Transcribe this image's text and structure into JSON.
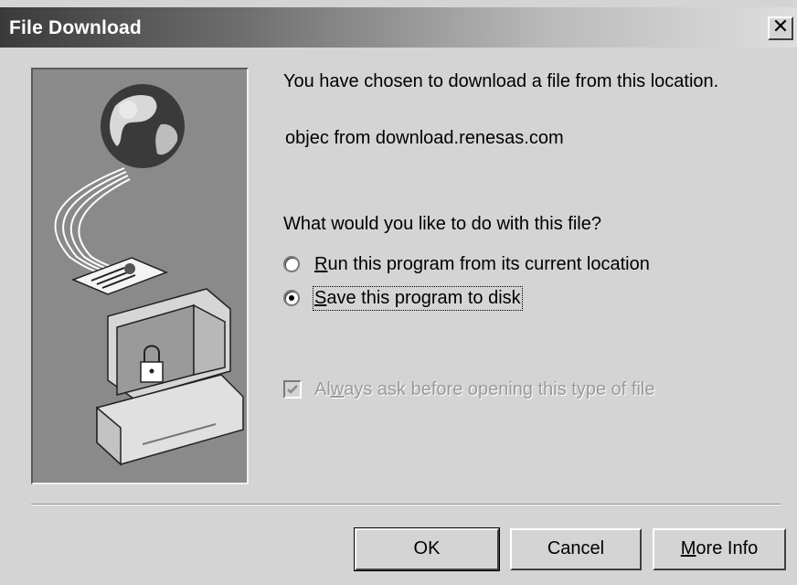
{
  "window": {
    "title": "File Download",
    "close_glyph": "✕"
  },
  "message": {
    "intro": "You have chosen to download a file from this location.",
    "source": "objec from download.renesas.com",
    "question": "What would you like to do with this file?"
  },
  "options": [
    {
      "label_accel": "R",
      "label_rest": "un this program from its current location",
      "selected": false
    },
    {
      "label_accel": "S",
      "label_rest": "ave this program to disk",
      "selected": true
    }
  ],
  "checkbox": {
    "label_pre": "Al",
    "label_accel": "w",
    "label_rest": "ays ask before opening this type of file",
    "checked": true,
    "enabled": false
  },
  "buttons": {
    "ok": "OK",
    "cancel": "Cancel",
    "more_accel": "M",
    "more_rest": "ore Info"
  },
  "illustration": {
    "icons": [
      "globe-icon",
      "document-icon",
      "computer-icon",
      "padlock-icon"
    ]
  }
}
